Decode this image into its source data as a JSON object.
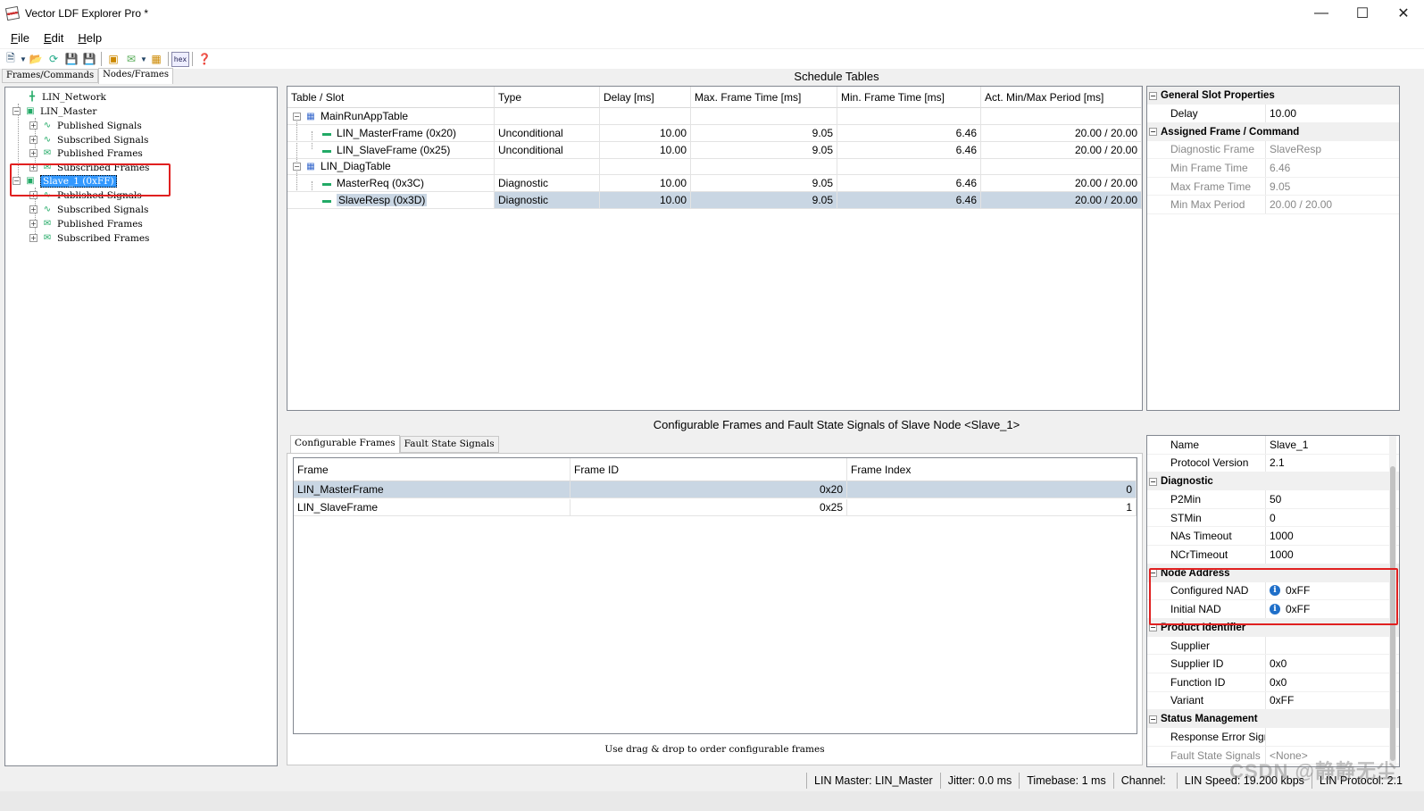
{
  "window": {
    "title": "Vector LDF Explorer Pro *"
  },
  "menu": [
    {
      "key": "F",
      "rest": "ile"
    },
    {
      "key": "E",
      "rest": "dit"
    },
    {
      "key": "H",
      "rest": "elp"
    }
  ],
  "toolbar": {
    "hex_label": "hex"
  },
  "left_tabs": [
    "Frames/Commands",
    "Nodes/Frames"
  ],
  "tree": {
    "network": "LIN_Network",
    "master": "LIN_Master",
    "master_children": [
      "Published Signals",
      "Subscribed Signals",
      "Published Frames",
      "Subscribed Frames"
    ],
    "slave": "Slave_1 (0xFF)",
    "slave_children": [
      "Published Signals",
      "Subscribed Signals",
      "Published Frames",
      "Subscribed Frames"
    ]
  },
  "schedule": {
    "header": "Schedule Tables",
    "columns": [
      "Table / Slot",
      "Type",
      "Delay [ms]",
      "Max. Frame Time [ms]",
      "Min. Frame Time [ms]",
      "Act. Min/Max Period [ms]"
    ],
    "tables": [
      {
        "name": "MainRunAppTable",
        "slots": [
          {
            "name": "LIN_MasterFrame (0x20)",
            "type": "Unconditional",
            "delay": "10.00",
            "max": "9.05",
            "min": "6.46",
            "period": "20.00 / 20.00"
          },
          {
            "name": "LIN_SlaveFrame (0x25)",
            "type": "Unconditional",
            "delay": "10.00",
            "max": "9.05",
            "min": "6.46",
            "period": "20.00 / 20.00"
          }
        ]
      },
      {
        "name": "LIN_DiagTable",
        "slots": [
          {
            "name": "MasterReq (0x3C)",
            "type": "Diagnostic",
            "delay": "10.00",
            "max": "9.05",
            "min": "6.46",
            "period": "20.00 / 20.00"
          },
          {
            "name": "SlaveResp (0x3D)",
            "type": "Diagnostic",
            "delay": "10.00",
            "max": "9.05",
            "min": "6.46",
            "period": "20.00 / 20.00"
          }
        ]
      }
    ]
  },
  "slot_props": {
    "general_cat": "General Slot Properties",
    "delay_label": "Delay",
    "delay_value": "10.00",
    "assigned_cat": "Assigned Frame / Command",
    "rows": [
      {
        "k": "Diagnostic Frame",
        "v": "SlaveResp"
      },
      {
        "k": "Min Frame Time",
        "v": "6.46"
      },
      {
        "k": "Max Frame Time",
        "v": "9.05"
      },
      {
        "k": "Min Max Period",
        "v": "20.00 / 20.00"
      }
    ]
  },
  "config": {
    "header": "Configurable Frames and Fault State Signals of Slave Node <Slave_1>",
    "tabs": [
      "Configurable Frames",
      "Fault State Signals"
    ],
    "columns": [
      "Frame",
      "Frame ID",
      "Frame Index"
    ],
    "rows": [
      {
        "frame": "LIN_MasterFrame",
        "id": "0x20",
        "index": "0"
      },
      {
        "frame": "LIN_SlaveFrame",
        "id": "0x25",
        "index": "1"
      }
    ],
    "hint": "Use drag & drop to order configurable frames"
  },
  "node_props": {
    "top": [
      {
        "k": "Name",
        "v": "Slave_1"
      },
      {
        "k": "Protocol Version",
        "v": "2.1"
      }
    ],
    "diag_cat": "Diagnostic",
    "diag": [
      {
        "k": "P2Min",
        "v": "50"
      },
      {
        "k": "STMin",
        "v": "0"
      },
      {
        "k": "NAs Timeout",
        "v": "1000"
      },
      {
        "k": "NCrTimeout",
        "v": "1000"
      }
    ],
    "addr_cat": "Node Address",
    "addr": [
      {
        "k": "Configured NAD",
        "v": "0xFF"
      },
      {
        "k": "Initial NAD",
        "v": "0xFF"
      }
    ],
    "prod_cat": "Product Identifier",
    "prod": [
      {
        "k": "Supplier",
        "v": ""
      },
      {
        "k": "Supplier ID",
        "v": "0x0"
      },
      {
        "k": "Function ID",
        "v": "0x0"
      },
      {
        "k": "Variant",
        "v": "0xFF"
      }
    ],
    "status_cat": "Status Management",
    "status": [
      {
        "k": "Response Error Sign",
        "v": ""
      },
      {
        "k": "Fault State Signals",
        "v": "<None>"
      }
    ]
  },
  "statusbar": {
    "master": "LIN Master: LIN_Master",
    "jitter": "Jitter: 0.0 ms",
    "timebase": "Timebase: 1 ms",
    "channel": "Channel:",
    "speed": "LIN Speed: 19.200 kbps",
    "protocol": "LIN Protocol: 2.1"
  },
  "watermark": "CSDN @静静无尘",
  "colors": {
    "highlight": "#e02020",
    "selection": "#3399ff",
    "selected_row": "#c9d6e3"
  }
}
